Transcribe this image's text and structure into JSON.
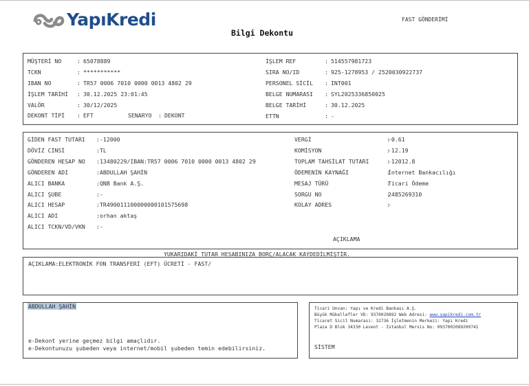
{
  "header": {
    "brand": "YapıKredi",
    "transfer_type": "FAST GÖNDERİMİ",
    "doc_title": "Bilgi Dekontu"
  },
  "customer_left": [
    {
      "label": "MÜŞTERİ NO",
      "value": "65078889"
    },
    {
      "label": "TCKN",
      "value": "***********"
    },
    {
      "label": "IBAN NO",
      "value": "TR57 0006 7010 0000 0013 4802 29"
    },
    {
      "label": "İŞLEM TARİHİ",
      "value": "30.12.2025 23:01:45"
    },
    {
      "label": "VALÖR",
      "value": "30/12/2025"
    }
  ],
  "customer_left_last": {
    "label": "DEKONT TİPİ",
    "value": "EFT",
    "scenario_label": "SENARYO",
    "scenario_value": "DEKONT"
  },
  "customer_right": [
    {
      "label": "İŞLEM REF",
      "value": "514557981723"
    },
    {
      "label": "SIRA NO/ID",
      "value": "925-1278953 / 2520030922737"
    },
    {
      "label": "PERSONEL SİCİL",
      "value": "INT001"
    },
    {
      "label": "BELGE NUMARASI",
      "value": "SYL2025336850025"
    },
    {
      "label": "BELGE TARİHİ",
      "value": "30.12.2025"
    },
    {
      "label": "ETTN",
      "value": "-"
    }
  ],
  "transaction_left": [
    {
      "label": "GİDEN FAST TUTARI",
      "value": "-12000"
    },
    {
      "label": "DÖVİZ CİNSİ",
      "value": "TL"
    },
    {
      "label": "GÖNDEREN HESAP NO",
      "value": "13480229/IBAN:TR57 0006 7010 0000 0013 4802 29"
    },
    {
      "label": "GÖNDEREN ADI",
      "value": "ABDULLAH ŞAHİN"
    },
    {
      "label": "ALICI BANKA",
      "value": "QNB Bank A.Ş."
    },
    {
      "label": "ALICI ŞUBE",
      "value": "-"
    },
    {
      "label": "ALICI HESAP",
      "value": "TR490011100000000101575698"
    },
    {
      "label": "ALICI ADI",
      "value": "orhan aktaş"
    },
    {
      "label": "ALICI TCKN/VD/VKN",
      "value": "-"
    }
  ],
  "transaction_right": [
    {
      "label": "VERGİ",
      "value": "-0.61"
    },
    {
      "label": "KOMİSYON",
      "value": "-12.19"
    },
    {
      "label": "TOPLAM TAHSİLAT TUTARI",
      "value": "-12012.8"
    },
    {
      "label": "ÖDEMENİN KAYNAĞI",
      "value": "İnternet Bankacılığı"
    },
    {
      "label": "MESAJ TÜRÜ",
      "value": "Ticari Ödeme"
    },
    {
      "label": "SORGU NO",
      "value": "2485269310"
    },
    {
      "label": "KOLAY ADRES",
      "value": "-"
    }
  ],
  "explanation_heading": "AÇIKLAMA",
  "notice": "YUKARIDAKİ TUTAR HESABINIZA BORÇ/ALACAK KAYDEDİLMİŞTİR.",
  "description": "AÇIKLAMA:ELEKTRONİK FON TRANSFERİ (EFT) ÜCRETİ - FAST/",
  "footer_left": {
    "name": "ABDULLAH ŞAHİN",
    "line1": "e-Dekont yerine geçmez bilgi amaçlıdır.",
    "line2": "e-Dekontunuzu şubeden veya internet/mobil şubeden temin edebilirsiniz."
  },
  "footer_right": {
    "line1": "Ticari Unvan: Yapı ve Kredi Bankası A.Ş.",
    "line2_pre": "Büyük Mükellefler VD: 9370020892 Web Adresi: ",
    "line2_link": "www.yapikredi.com.tr",
    "line3": "Ticaret Sicil Numarası: 32736 İşletmenin Merkezi: Yapı Kredi",
    "line4": "Plaza D Blok 34330 Levent - İstanbul Mersis No: 0937002089200741",
    "system": "SİSTEM"
  },
  "colors": {
    "brand": "#1f4e8c",
    "logo_grey": "#8a8a8a",
    "selection": "#b7cce3",
    "link": "#1a3fbf"
  }
}
